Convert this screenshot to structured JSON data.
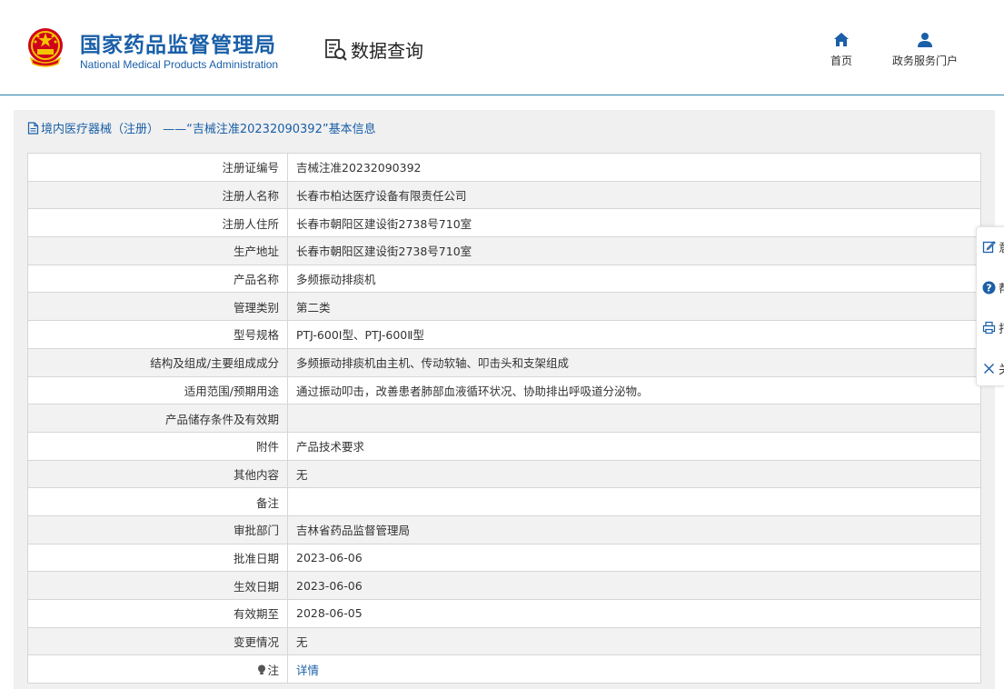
{
  "header": {
    "brand_cn": "国家药品监督管理局",
    "brand_en": "National Medical Products Administration",
    "query_label": "数据查询",
    "nav": {
      "home": "首页",
      "portal": "政务服务门户"
    }
  },
  "panel": {
    "title": "境内医疗器械（注册） ——“吉械注准20232090392”基本信息"
  },
  "rows": [
    {
      "label": "注册证编号",
      "value": "吉械注准20232090392"
    },
    {
      "label": "注册人名称",
      "value": "长春市柏达医疗设备有限责任公司"
    },
    {
      "label": "注册人住所",
      "value": "长春市朝阳区建设街2738号710室"
    },
    {
      "label": "生产地址",
      "value": "长春市朝阳区建设街2738号710室"
    },
    {
      "label": "产品名称",
      "value": "多频振动排痰机"
    },
    {
      "label": "管理类别",
      "value": "第二类"
    },
    {
      "label": "型号规格",
      "value": "PTJ-600Ⅰ型、PTJ-600Ⅱ型"
    },
    {
      "label": "结构及组成/主要组成成分",
      "value": "多频振动排痰机由主机、传动软轴、叩击头和支架组成"
    },
    {
      "label": "适用范围/预期用途",
      "value": "通过振动叩击，改善患者肺部血液循环状况、协助排出呼吸道分泌物。"
    },
    {
      "label": "产品储存条件及有效期",
      "value": ""
    },
    {
      "label": "附件",
      "value": "产品技术要求"
    },
    {
      "label": "其他内容",
      "value": "无"
    },
    {
      "label": "备注",
      "value": ""
    },
    {
      "label": "审批部门",
      "value": "吉林省药品监督管理局"
    },
    {
      "label": "批准日期",
      "value": "2023-06-06"
    },
    {
      "label": "生效日期",
      "value": "2023-06-06"
    },
    {
      "label": "有效期至",
      "value": "2028-06-05"
    },
    {
      "label": "变更情况",
      "value": "无"
    }
  ],
  "note_row": {
    "label": "注",
    "link": "详情"
  },
  "side_bar": {
    "feedback": "意",
    "help": "帮",
    "print": "打",
    "close": "关"
  },
  "colors": {
    "brand_blue": "#1a5fa8",
    "header_line": "#2a7fa8",
    "row_alt": "#f2f2f2"
  }
}
